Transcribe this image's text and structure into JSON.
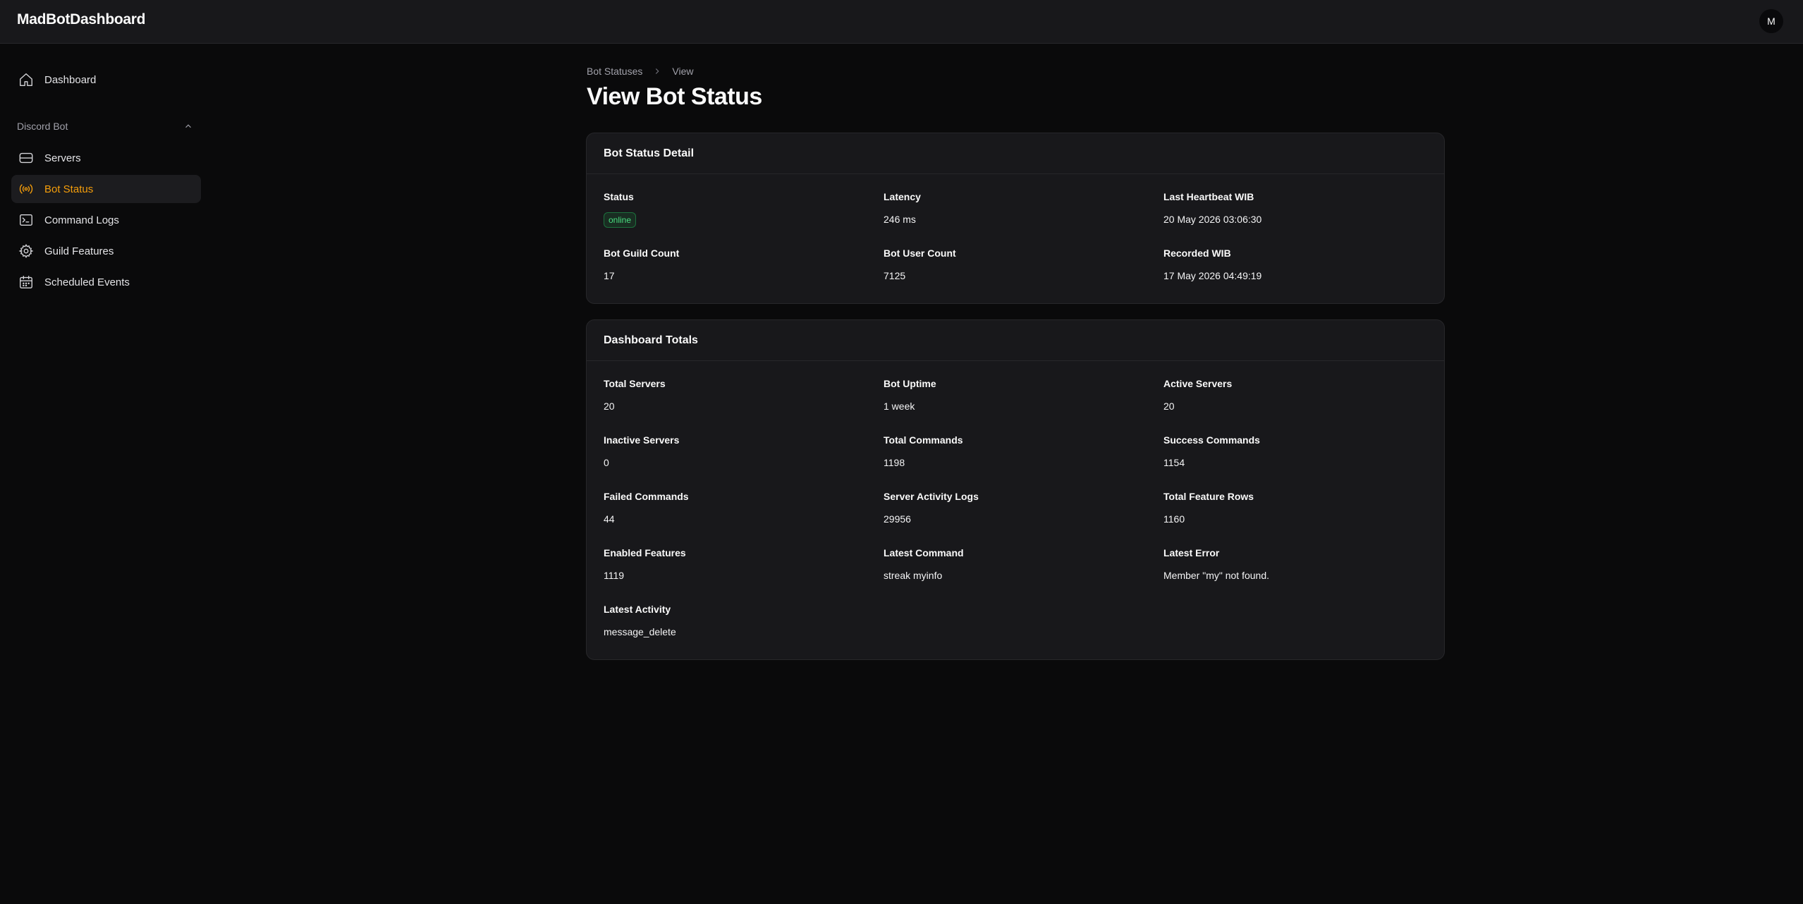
{
  "app": {
    "brand": "MadBotDashboard",
    "avatar_initial": "M"
  },
  "sidebar": {
    "dashboard": {
      "label": "Dashboard",
      "icon": "home-icon"
    },
    "group": {
      "label": "Discord Bot",
      "icon": "chevron-up-icon"
    },
    "items": [
      {
        "label": "Servers",
        "icon": "server-icon"
      },
      {
        "label": "Bot Status",
        "icon": "broadcast-icon",
        "active": true
      },
      {
        "label": "Command Logs",
        "icon": "terminal-icon"
      },
      {
        "label": "Guild Features",
        "icon": "gear-icon"
      },
      {
        "label": "Scheduled Events",
        "icon": "calendar-icon"
      }
    ]
  },
  "breadcrumb": {
    "parent": "Bot Statuses",
    "current": "View"
  },
  "page_title": "View Bot Status",
  "detail": {
    "title": "Bot Status Detail",
    "status_label": "Status",
    "status_value": "online",
    "latency_label": "Latency",
    "latency_value": "246 ms",
    "heartbeat_label": "Last Heartbeat WIB",
    "heartbeat_value": "20 May 2026 03:06:30",
    "guild_count_label": "Bot Guild Count",
    "guild_count_value": "17",
    "user_count_label": "Bot User Count",
    "user_count_value": "7125",
    "recorded_label": "Recorded WIB",
    "recorded_value": "17 May 2026 04:49:19"
  },
  "totals": {
    "title": "Dashboard Totals",
    "fields": [
      {
        "label": "Total Servers",
        "value": "20"
      },
      {
        "label": "Bot Uptime",
        "value": "1 week"
      },
      {
        "label": "Active Servers",
        "value": "20"
      },
      {
        "label": "Inactive Servers",
        "value": "0"
      },
      {
        "label": "Total Commands",
        "value": "1198"
      },
      {
        "label": "Success Commands",
        "value": "1154"
      },
      {
        "label": "Failed Commands",
        "value": "44"
      },
      {
        "label": "Server Activity Logs",
        "value": "29956"
      },
      {
        "label": "Total Feature Rows",
        "value": "1160"
      },
      {
        "label": "Enabled Features",
        "value": "1119"
      },
      {
        "label": "Latest Command",
        "value": "streak myinfo"
      },
      {
        "label": "Latest Error",
        "value": "Member \"my\" not found."
      },
      {
        "label": "Latest Activity",
        "value": "message_delete"
      }
    ]
  },
  "colors": {
    "accent": "#f59e0b",
    "success": "#4ade80",
    "background": "#0a0a0b",
    "card": "#18181b"
  }
}
